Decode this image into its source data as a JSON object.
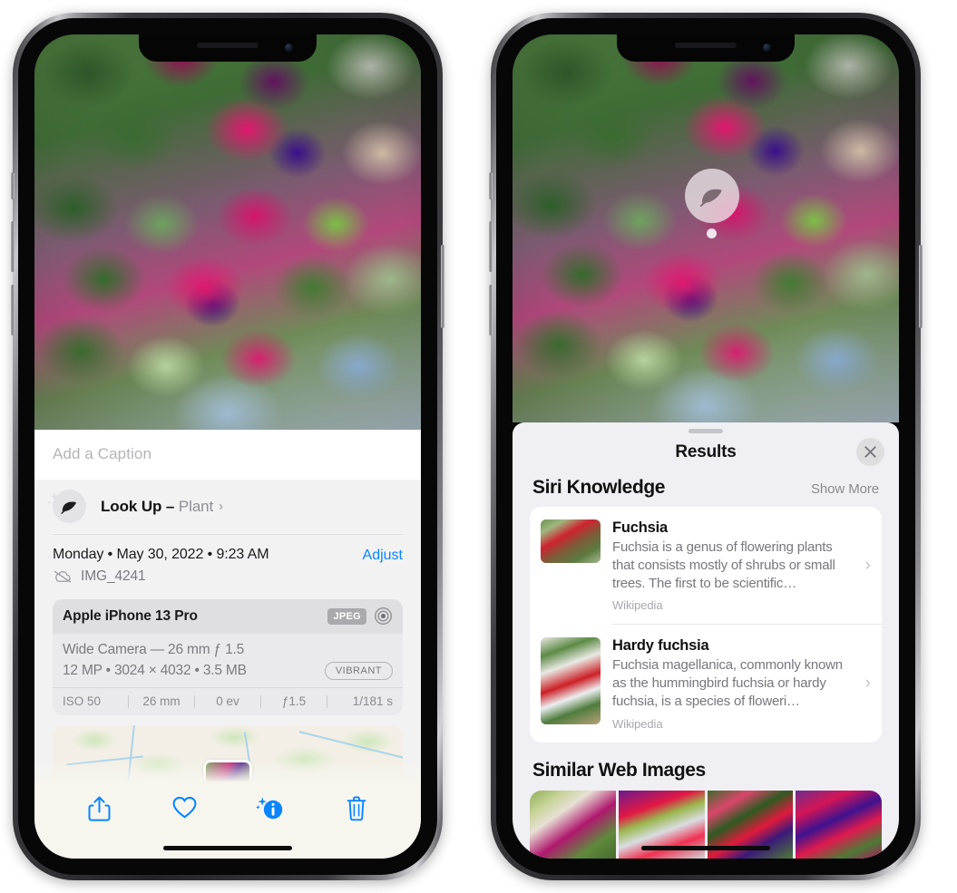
{
  "left_phone": {
    "photo": {
      "alt": "fuchsia-flowers-photo"
    },
    "caption_field": {
      "placeholder": "Add a Caption",
      "value": ""
    },
    "look_up": {
      "label": "Look Up",
      "dash": "–",
      "subject": "Plant",
      "chevron": "›",
      "icon": "leaf-icon"
    },
    "date_row": {
      "date": "Monday • May 30, 2022 • 9:23 AM",
      "adjust": "Adjust"
    },
    "file_row": {
      "filename": "IMG_4241",
      "icon": "cloud-slash-icon"
    },
    "exif": {
      "device": "Apple iPhone 13 Pro",
      "format_badge": "JPEG",
      "lens_icon": "aperture-icon",
      "lens_line": "Wide Camera — 26 mm ƒ 1.5",
      "specs_line": "12 MP • 3024 × 4032 • 3.5 MB",
      "profile_badge": "VIBRANT",
      "settings": [
        "ISO 50",
        "26 mm",
        "0 ev",
        "ƒ1.5",
        "1/181 s"
      ]
    },
    "map": {
      "name": "location-map-thumbnail"
    },
    "toolbar": [
      {
        "name": "share-button",
        "icon": "share-icon"
      },
      {
        "name": "favorite-button",
        "icon": "heart-icon"
      },
      {
        "name": "info-button",
        "icon": "info-sparkle-icon"
      },
      {
        "name": "delete-button",
        "icon": "trash-icon"
      }
    ]
  },
  "right_phone": {
    "photo": {
      "alt": "fuchsia-flowers-photo"
    },
    "vlu_badge": {
      "icon": "leaf-icon"
    },
    "sheet": {
      "title": "Results",
      "close_label": "✕",
      "siri_section": {
        "title": "Siri Knowledge",
        "show_more": "Show More"
      },
      "knowledge_items": [
        {
          "title": "Fuchsia",
          "description": "Fuchsia is a genus of flowering plants that consists mostly of shrubs or small trees. The first to be scientific…",
          "source": "Wikipedia",
          "chevron": "›"
        },
        {
          "title": "Hardy fuchsia",
          "description": "Fuchsia magellanica, commonly known as the hummingbird fuchsia or hardy fuchsia, is a species of floweri…",
          "source": "Wikipedia",
          "chevron": "›"
        }
      ],
      "web_section": {
        "title": "Similar Web Images"
      },
      "web_images": [
        "web-image-1",
        "web-image-2",
        "web-image-3",
        "web-image-4"
      ]
    }
  },
  "colors": {
    "accent_blue": "#0a84ff",
    "sheet_bg_left": "#f2f2f3",
    "sheet_bg_right": "#f0eff4",
    "toolbar_bg": "#f6f6ef",
    "card_white": "#ffffff",
    "secondary_text": "#8e8e93"
  }
}
